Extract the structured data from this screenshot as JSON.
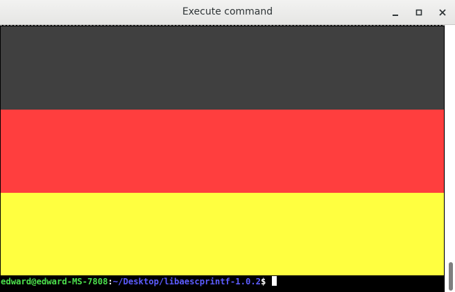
{
  "window": {
    "title": "Execute command",
    "buttons": {
      "minimize": "‗",
      "maximize": "□",
      "close": "✕"
    }
  },
  "terminal": {
    "background": "#000000",
    "flag_stripes": [
      {
        "color": "#404040"
      },
      {
        "color": "#ff3e3e"
      },
      {
        "color": "#ffff40"
      }
    ],
    "prompt": {
      "user_host": "edward@edward-MS-7808",
      "separator": ":",
      "path": "~/Desktop/libaescprintf-1.0.2",
      "symbol": "$",
      "user_host_color": "#4ce04c",
      "path_color": "#5c5cff",
      "symbol_color": "#ffffff"
    }
  }
}
